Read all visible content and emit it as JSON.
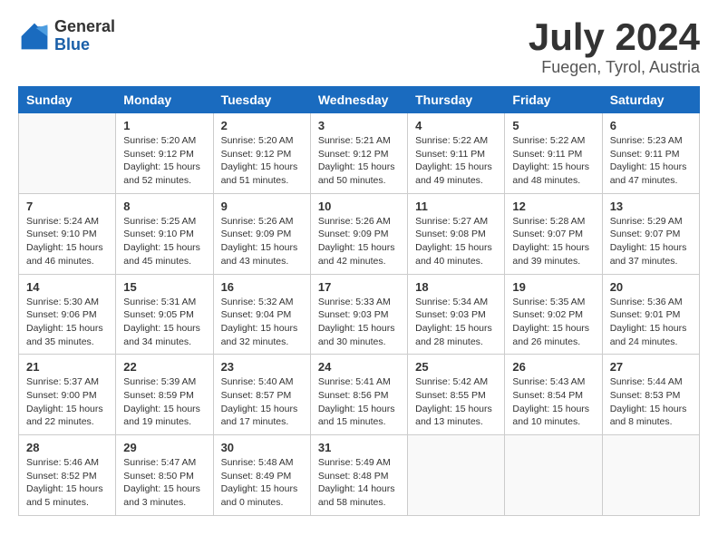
{
  "header": {
    "logo_general": "General",
    "logo_blue": "Blue",
    "month_year": "July 2024",
    "location": "Fuegen, Tyrol, Austria"
  },
  "calendar": {
    "days_of_week": [
      "Sunday",
      "Monday",
      "Tuesday",
      "Wednesday",
      "Thursday",
      "Friday",
      "Saturday"
    ],
    "weeks": [
      [
        {
          "day": "",
          "info": ""
        },
        {
          "day": "1",
          "info": "Sunrise: 5:20 AM\nSunset: 9:12 PM\nDaylight: 15 hours\nand 52 minutes."
        },
        {
          "day": "2",
          "info": "Sunrise: 5:20 AM\nSunset: 9:12 PM\nDaylight: 15 hours\nand 51 minutes."
        },
        {
          "day": "3",
          "info": "Sunrise: 5:21 AM\nSunset: 9:12 PM\nDaylight: 15 hours\nand 50 minutes."
        },
        {
          "day": "4",
          "info": "Sunrise: 5:22 AM\nSunset: 9:11 PM\nDaylight: 15 hours\nand 49 minutes."
        },
        {
          "day": "5",
          "info": "Sunrise: 5:22 AM\nSunset: 9:11 PM\nDaylight: 15 hours\nand 48 minutes."
        },
        {
          "day": "6",
          "info": "Sunrise: 5:23 AM\nSunset: 9:11 PM\nDaylight: 15 hours\nand 47 minutes."
        }
      ],
      [
        {
          "day": "7",
          "info": "Sunrise: 5:24 AM\nSunset: 9:10 PM\nDaylight: 15 hours\nand 46 minutes."
        },
        {
          "day": "8",
          "info": "Sunrise: 5:25 AM\nSunset: 9:10 PM\nDaylight: 15 hours\nand 45 minutes."
        },
        {
          "day": "9",
          "info": "Sunrise: 5:26 AM\nSunset: 9:09 PM\nDaylight: 15 hours\nand 43 minutes."
        },
        {
          "day": "10",
          "info": "Sunrise: 5:26 AM\nSunset: 9:09 PM\nDaylight: 15 hours\nand 42 minutes."
        },
        {
          "day": "11",
          "info": "Sunrise: 5:27 AM\nSunset: 9:08 PM\nDaylight: 15 hours\nand 40 minutes."
        },
        {
          "day": "12",
          "info": "Sunrise: 5:28 AM\nSunset: 9:07 PM\nDaylight: 15 hours\nand 39 minutes."
        },
        {
          "day": "13",
          "info": "Sunrise: 5:29 AM\nSunset: 9:07 PM\nDaylight: 15 hours\nand 37 minutes."
        }
      ],
      [
        {
          "day": "14",
          "info": "Sunrise: 5:30 AM\nSunset: 9:06 PM\nDaylight: 15 hours\nand 35 minutes."
        },
        {
          "day": "15",
          "info": "Sunrise: 5:31 AM\nSunset: 9:05 PM\nDaylight: 15 hours\nand 34 minutes."
        },
        {
          "day": "16",
          "info": "Sunrise: 5:32 AM\nSunset: 9:04 PM\nDaylight: 15 hours\nand 32 minutes."
        },
        {
          "day": "17",
          "info": "Sunrise: 5:33 AM\nSunset: 9:03 PM\nDaylight: 15 hours\nand 30 minutes."
        },
        {
          "day": "18",
          "info": "Sunrise: 5:34 AM\nSunset: 9:03 PM\nDaylight: 15 hours\nand 28 minutes."
        },
        {
          "day": "19",
          "info": "Sunrise: 5:35 AM\nSunset: 9:02 PM\nDaylight: 15 hours\nand 26 minutes."
        },
        {
          "day": "20",
          "info": "Sunrise: 5:36 AM\nSunset: 9:01 PM\nDaylight: 15 hours\nand 24 minutes."
        }
      ],
      [
        {
          "day": "21",
          "info": "Sunrise: 5:37 AM\nSunset: 9:00 PM\nDaylight: 15 hours\nand 22 minutes."
        },
        {
          "day": "22",
          "info": "Sunrise: 5:39 AM\nSunset: 8:59 PM\nDaylight: 15 hours\nand 19 minutes."
        },
        {
          "day": "23",
          "info": "Sunrise: 5:40 AM\nSunset: 8:57 PM\nDaylight: 15 hours\nand 17 minutes."
        },
        {
          "day": "24",
          "info": "Sunrise: 5:41 AM\nSunset: 8:56 PM\nDaylight: 15 hours\nand 15 minutes."
        },
        {
          "day": "25",
          "info": "Sunrise: 5:42 AM\nSunset: 8:55 PM\nDaylight: 15 hours\nand 13 minutes."
        },
        {
          "day": "26",
          "info": "Sunrise: 5:43 AM\nSunset: 8:54 PM\nDaylight: 15 hours\nand 10 minutes."
        },
        {
          "day": "27",
          "info": "Sunrise: 5:44 AM\nSunset: 8:53 PM\nDaylight: 15 hours\nand 8 minutes."
        }
      ],
      [
        {
          "day": "28",
          "info": "Sunrise: 5:46 AM\nSunset: 8:52 PM\nDaylight: 15 hours\nand 5 minutes."
        },
        {
          "day": "29",
          "info": "Sunrise: 5:47 AM\nSunset: 8:50 PM\nDaylight: 15 hours\nand 3 minutes."
        },
        {
          "day": "30",
          "info": "Sunrise: 5:48 AM\nSunset: 8:49 PM\nDaylight: 15 hours\nand 0 minutes."
        },
        {
          "day": "31",
          "info": "Sunrise: 5:49 AM\nSunset: 8:48 PM\nDaylight: 14 hours\nand 58 minutes."
        },
        {
          "day": "",
          "info": ""
        },
        {
          "day": "",
          "info": ""
        },
        {
          "day": "",
          "info": ""
        }
      ]
    ]
  }
}
